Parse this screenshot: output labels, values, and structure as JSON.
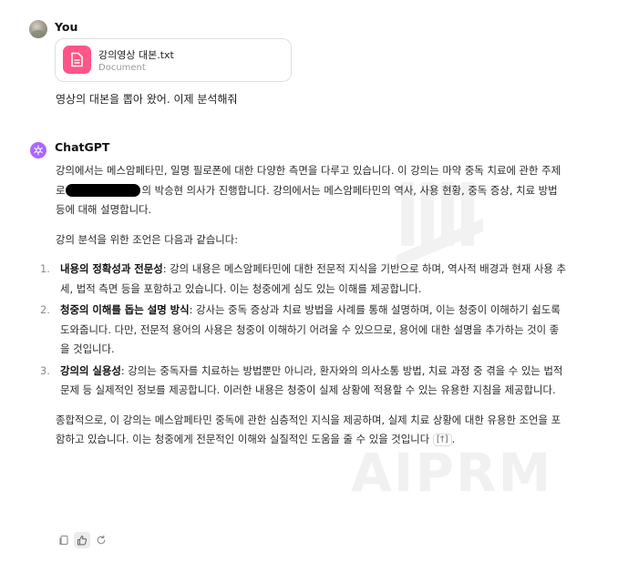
{
  "user_message": {
    "author": "You",
    "attachment": {
      "file_name": "강의영상 대본.txt",
      "file_type": "Document",
      "icon": "document-icon"
    },
    "text": "영상의 대본을 뽑아 왔어. 이제 분석해줘"
  },
  "assistant_message": {
    "author": "ChatGPT",
    "intro_before_redaction": "강의에서는 메스암페타민, 일명 필로폰에 대한 다양한 측면을 다루고 있습니다. 이 강의는 마약 중독 치료에 관한 주제로",
    "intro_after_redaction": "의 박승현 의사가 진행합니다. 강의에서는 메스암페타민의 역사, 사용 현황, 중독 증상, 치료 방법 등에 대해 설명합니다.",
    "lead": "강의 분석을 위한 조언은 다음과 같습니다:",
    "points": [
      {
        "number": "1.",
        "title": "내용의 정확성과 전문성",
        "text": ": 강의 내용은 메스암페타민에 대한 전문적 지식을 기반으로 하며, 역사적 배경과 현재 사용 추세, 법적 측면 등을 포함하고 있습니다. 이는 청중에게 심도 있는 이해를 제공합니다."
      },
      {
        "number": "2.",
        "title": "청중의 이해를 돕는 설명 방식",
        "text": ": 강사는 중독 증상과 치료 방법을 사례를 통해 설명하며, 이는 청중이 이해하기 쉽도록 도와줍니다. 다만, 전문적 용어의 사용은 청중이 이해하기 어려울 수 있으므로, 용어에 대한 설명을 추가하는 것이 좋을 것입니다."
      },
      {
        "number": "3.",
        "title": "강의의 실용성",
        "text": ": 강의는 중독자를 치료하는 방법뿐만 아니라, 환자와의 의사소통 방법, 치료 과정 중 겪을 수 있는 법적 문제 등 실제적인 정보를 제공합니다. 이러한 내용은 청중이 실제 상황에 적용할 수 있는 유용한 지침을 제공합니다."
      }
    ],
    "summary": "종합적으로, 이 강의는 메스암페타민 중독에 관한 심층적인 지식을 제공하며, 실제 치료 상황에 대한 유용한 조언을 포함하고 있습니다. 이는 청중에게 전문적인 이해와 실질적인 도움을 줄 수 있을 것입니다",
    "citation": "[†]",
    "actions": [
      "copy-icon",
      "thumbs-up-icon",
      "regenerate-icon"
    ]
  },
  "watermark": {
    "text": "AIPRM"
  },
  "colors": {
    "file_icon_bg": "#ff5588",
    "gpt_avatar_bg": "#ab68ff",
    "text": "#2a2a2a",
    "muted": "#9a9a9a"
  }
}
